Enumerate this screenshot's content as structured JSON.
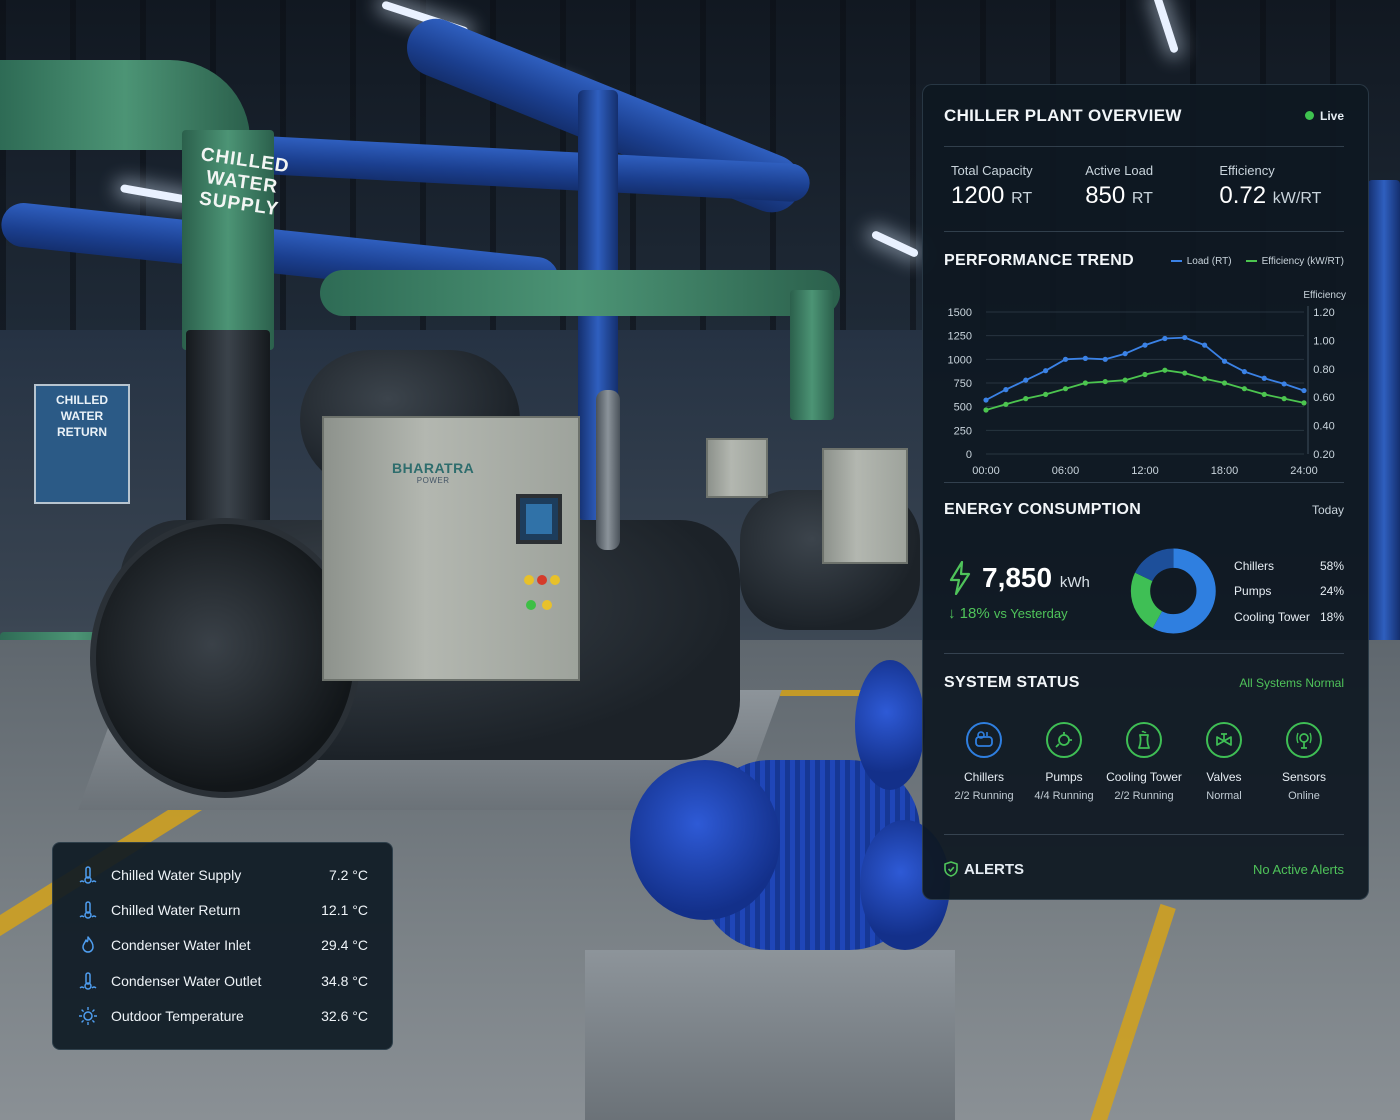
{
  "scene": {
    "pipe_label_supply": "CHILLED\nWATER\nSUPPLY",
    "sign_return": "CHILLED\nWATER\nRETURN",
    "brand_name": "BHARATRA",
    "brand_sub": "POWER"
  },
  "dashboard": {
    "title": "CHILLER PLANT OVERVIEW",
    "live_label": "Live",
    "kpis": [
      {
        "label": "Total Capacity",
        "value": "1200",
        "unit": "RT"
      },
      {
        "label": "Active Load",
        "value": "850",
        "unit": "RT"
      },
      {
        "label": "Efficiency",
        "value": "0.72",
        "unit": "kW/RT"
      }
    ],
    "trend": {
      "title": "PERFORMANCE TREND",
      "legend_load": "Load (RT)",
      "legend_eff": "Efficiency (kW/RT)"
    },
    "energy": {
      "title": "ENERGY CONSUMPTION",
      "period": "Today",
      "value": "7,850",
      "unit": "kWh",
      "delta": "18%",
      "delta_label": "vs Yesterday",
      "shares": [
        {
          "name": "Chillers",
          "pct": "58%",
          "value": 58,
          "color": "#2f7fe0"
        },
        {
          "name": "Pumps",
          "pct": "24%",
          "value": 24,
          "color": "#3fbf55"
        },
        {
          "name": "Cooling Tower",
          "pct": "18%",
          "value": 18,
          "color": "#1d4f9a"
        }
      ]
    },
    "status": {
      "title": "SYSTEM STATUS",
      "summary": "All Systems Normal",
      "items": [
        {
          "name": "Chillers",
          "state": "2/2 Running",
          "icon": "chiller-icon",
          "color": "#2f7fe0"
        },
        {
          "name": "Pumps",
          "state": "4/4 Running",
          "icon": "pump-icon",
          "color": "#3fbf55"
        },
        {
          "name": "Cooling Tower",
          "state": "2/2 Running",
          "icon": "cooling-tower-icon",
          "color": "#3fbf55"
        },
        {
          "name": "Valves",
          "state": "Normal",
          "icon": "valve-icon",
          "color": "#3fbf55"
        },
        {
          "name": "Sensors",
          "state": "Online",
          "icon": "sensor-icon",
          "color": "#3fbf55"
        }
      ]
    },
    "alerts": {
      "title": "ALERTS",
      "state": "No Active Alerts"
    }
  },
  "temperatures": [
    {
      "name": "Chilled Water Supply",
      "value": "7.2 °C"
    },
    {
      "name": "Chilled Water Return",
      "value": "12.1 °C"
    },
    {
      "name": "Condenser Water Inlet",
      "value": "29.4 °C"
    },
    {
      "name": "Condenser Water Outlet",
      "value": "34.8 °C"
    },
    {
      "name": "Outdoor Temperature",
      "value": "32.6 °C"
    }
  ],
  "chart_data": {
    "type": "line",
    "title": "PERFORMANCE TREND",
    "x_ticks": [
      "00:00",
      "06:00",
      "12:00",
      "18:00",
      "24:00"
    ],
    "x": [
      0,
      1.5,
      3,
      4.5,
      6,
      7.5,
      9,
      10.5,
      12,
      13.5,
      15,
      16.5,
      18,
      19.5,
      21,
      22.5,
      24
    ],
    "y_left_ticks": [
      "0",
      "250",
      "500",
      "750",
      "1000",
      "1250",
      "1500"
    ],
    "y_left_range": [
      0,
      1500
    ],
    "y_right_label": "Efficiency",
    "y_right_ticks": [
      "0.20",
      "0.40",
      "0.60",
      "0.80",
      "1.00",
      "1.20"
    ],
    "y_right_range": [
      0.2,
      1.2
    ],
    "series": [
      {
        "name": "Load (RT)",
        "axis": "left",
        "color": "#3b82e6",
        "values": [
          570,
          680,
          780,
          880,
          1000,
          1010,
          1000,
          1060,
          1150,
          1220,
          1230,
          1150,
          980,
          870,
          800,
          740,
          670
        ]
      },
      {
        "name": "Efficiency (kW/RT)",
        "axis": "right",
        "color": "#4cc54f",
        "values": [
          0.51,
          0.55,
          0.59,
          0.62,
          0.66,
          0.7,
          0.71,
          0.72,
          0.76,
          0.79,
          0.77,
          0.73,
          0.7,
          0.66,
          0.62,
          0.59,
          0.56
        ]
      }
    ],
    "grid": true,
    "legend": "top-right"
  }
}
